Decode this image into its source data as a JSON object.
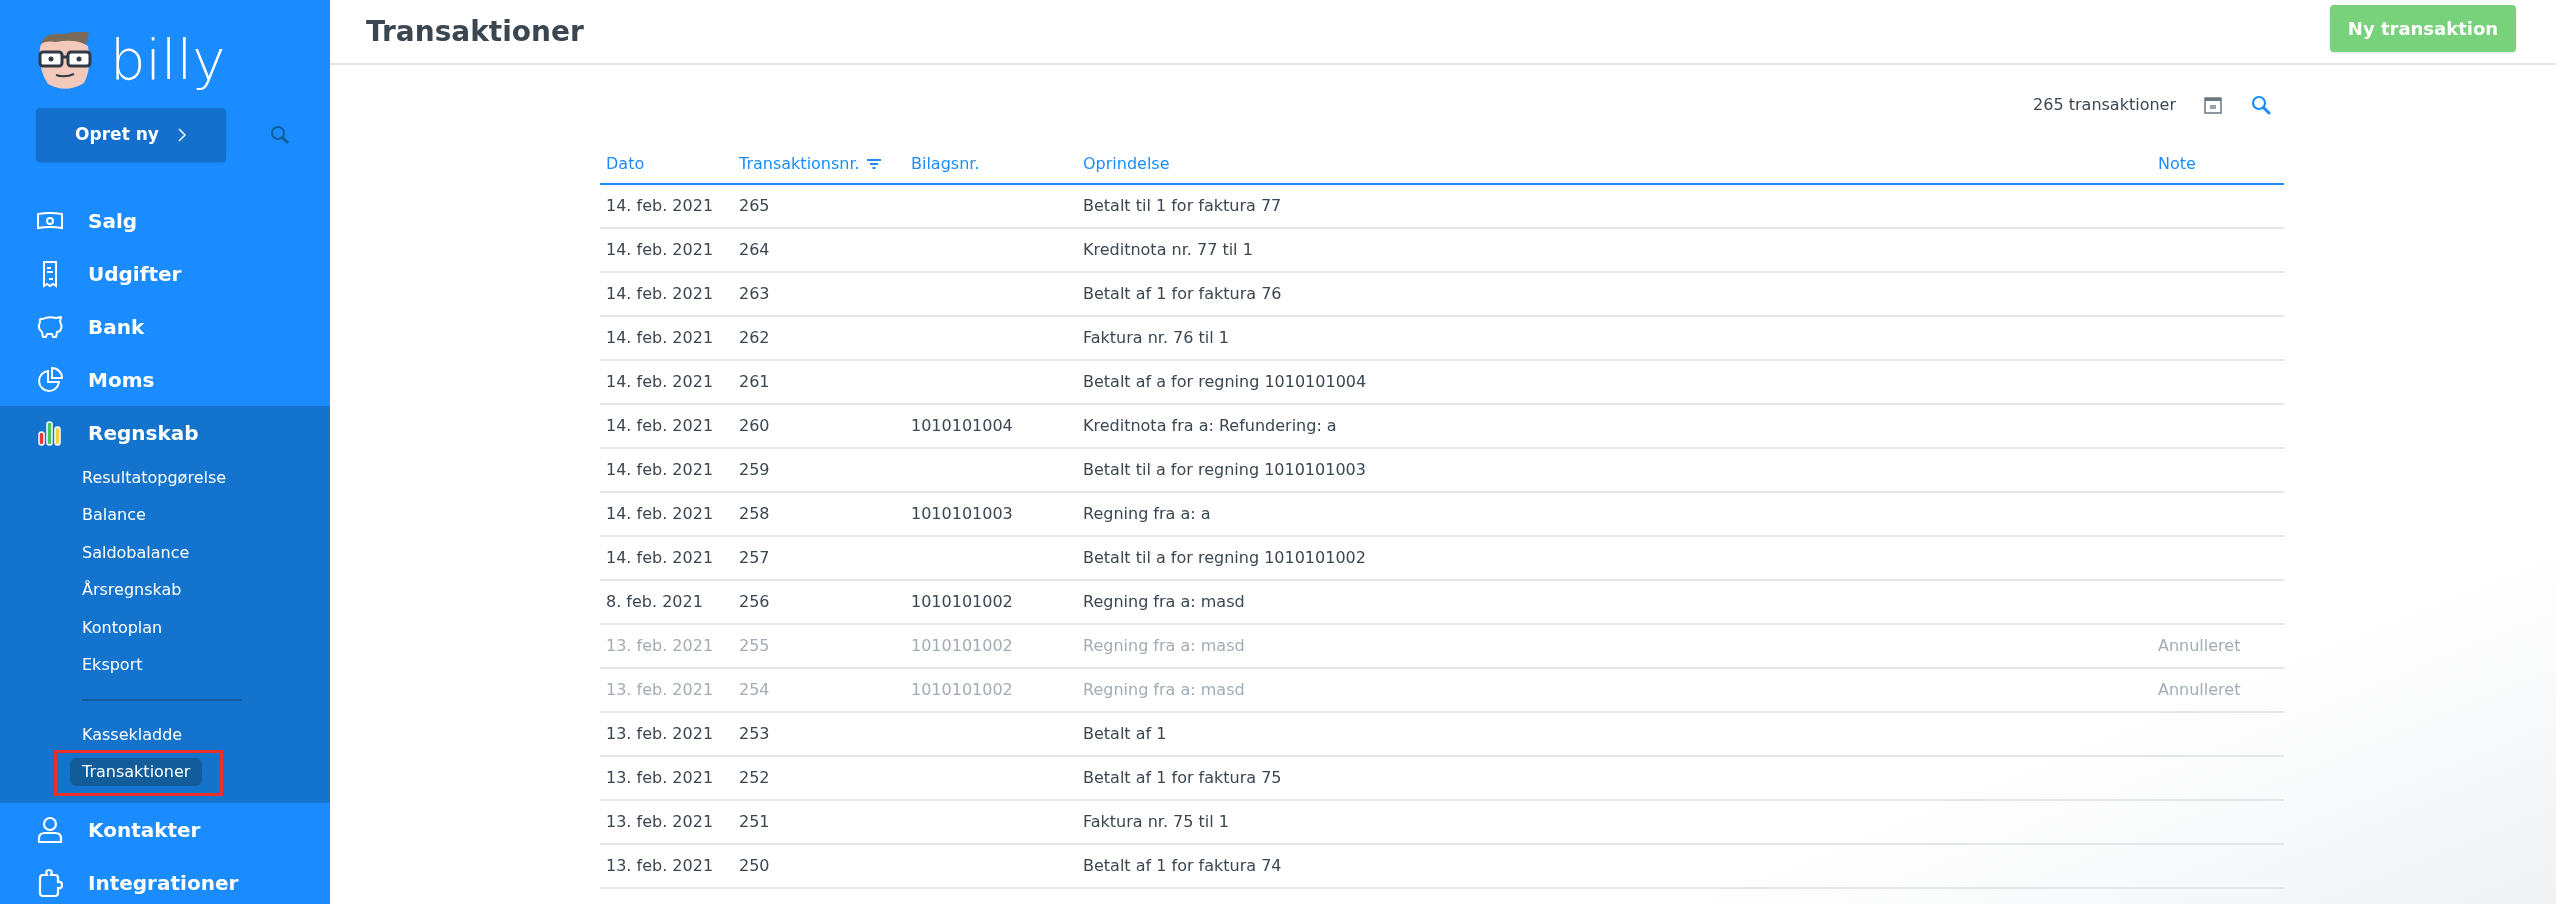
{
  "sidebar": {
    "logo": "billy",
    "create_button": "Opret ny",
    "nav": [
      {
        "label": "Salg",
        "selected": false
      },
      {
        "label": "Udgifter",
        "selected": false
      },
      {
        "label": "Bank",
        "selected": false
      },
      {
        "label": "Moms",
        "selected": false
      },
      {
        "label": "Regnskab",
        "selected": true,
        "children": [
          {
            "label": "Resultatopgørelse",
            "selected": false
          },
          {
            "label": "Balance",
            "selected": false
          },
          {
            "label": "Saldobalance",
            "selected": false
          },
          {
            "label": "Årsregnskab",
            "selected": false
          },
          {
            "label": "Kontoplan",
            "selected": false
          },
          {
            "label": "Eksport",
            "selected": false
          },
          {
            "kind": "divider"
          },
          {
            "label": "Kassekladde",
            "selected": false
          },
          {
            "label": "Transaktioner",
            "selected": true
          }
        ]
      },
      {
        "label": "Kontakter",
        "selected": false
      },
      {
        "label": "Integrationer",
        "selected": false
      }
    ]
  },
  "header": {
    "title": "Transaktioner",
    "button": "Ny transaktion"
  },
  "toolbar": {
    "count": "265 transaktioner"
  },
  "table": {
    "columns": [
      {
        "label": "Dato",
        "sorted": false
      },
      {
        "label": "Transaktionsnr.",
        "sorted": true
      },
      {
        "label": "Bilagsnr.",
        "sorted": false
      },
      {
        "label": "Oprindelse",
        "sorted": false
      },
      {
        "label": "Note",
        "sorted": false
      }
    ],
    "rows": [
      {
        "date": "14. feb. 2021",
        "number": "265",
        "voucher": "",
        "origin": "Betalt til 1 for faktura 77",
        "note": "",
        "voided": false
      },
      {
        "date": "14. feb. 2021",
        "number": "264",
        "voucher": "",
        "origin": "Kreditnota nr. 77 til 1",
        "note": "",
        "voided": false
      },
      {
        "date": "14. feb. 2021",
        "number": "263",
        "voucher": "",
        "origin": "Betalt af 1 for faktura 76",
        "note": "",
        "voided": false
      },
      {
        "date": "14. feb. 2021",
        "number": "262",
        "voucher": "",
        "origin": "Faktura nr. 76 til 1",
        "note": "",
        "voided": false
      },
      {
        "date": "14. feb. 2021",
        "number": "261",
        "voucher": "",
        "origin": "Betalt af a for regning 1010101004",
        "note": "",
        "voided": false
      },
      {
        "date": "14. feb. 2021",
        "number": "260",
        "voucher": "1010101004",
        "origin": "Kreditnota fra a: Refundering: a",
        "note": "",
        "voided": false
      },
      {
        "date": "14. feb. 2021",
        "number": "259",
        "voucher": "",
        "origin": "Betalt til a for regning 1010101003",
        "note": "",
        "voided": false
      },
      {
        "date": "14. feb. 2021",
        "number": "258",
        "voucher": "1010101003",
        "origin": "Regning fra a: a",
        "note": "",
        "voided": false
      },
      {
        "date": "14. feb. 2021",
        "number": "257",
        "voucher": "",
        "origin": "Betalt til a for regning 1010101002",
        "note": "",
        "voided": false
      },
      {
        "date": "8. feb. 2021",
        "number": "256",
        "voucher": "1010101002",
        "origin": "Regning fra a: masd",
        "note": "",
        "voided": false
      },
      {
        "date": "13. feb. 2021",
        "number": "255",
        "voucher": "1010101002",
        "origin": "Regning fra a: masd",
        "note": "Annulleret",
        "voided": true
      },
      {
        "date": "13. feb. 2021",
        "number": "254",
        "voucher": "1010101002",
        "origin": "Regning fra a: masd",
        "note": "Annulleret",
        "voided": true
      },
      {
        "date": "13. feb. 2021",
        "number": "253",
        "voucher": "",
        "origin": "Betalt af 1",
        "note": "",
        "voided": false
      },
      {
        "date": "13. feb. 2021",
        "number": "252",
        "voucher": "",
        "origin": "Betalt af 1 for faktura 75",
        "note": "",
        "voided": false
      },
      {
        "date": "13. feb. 2021",
        "number": "251",
        "voucher": "",
        "origin": "Faktura nr. 75 til 1",
        "note": "",
        "voided": false
      },
      {
        "date": "13. feb. 2021",
        "number": "250",
        "voucher": "",
        "origin": "Betalt af 1 for faktura 74",
        "note": "",
        "voided": false
      }
    ]
  }
}
